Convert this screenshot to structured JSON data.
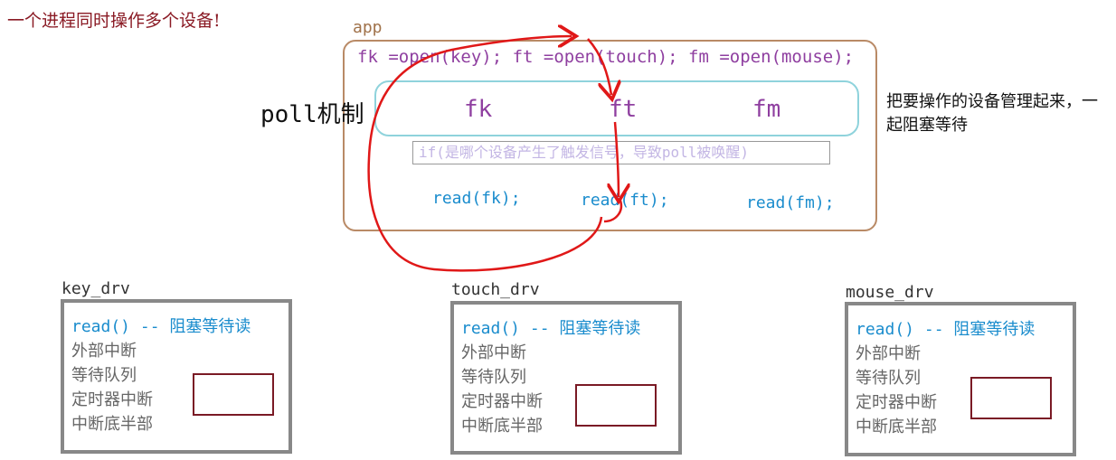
{
  "title": "一个进程同时操作多个设备!",
  "app": {
    "label": "app",
    "open_line": "fk =open(key); ft =open(touch); fm =open(mouse);",
    "poll_label": "poll机制",
    "fds": [
      "fk",
      "ft",
      "fm"
    ],
    "condition": "if(是哪个设备产生了触发信号，导致poll被唤醒)",
    "reads": [
      "read(fk);",
      "read(ft);",
      "read(fm);"
    ]
  },
  "note": "把要操作的设备管理起来，一起阻塞等待",
  "drivers": [
    {
      "label": "key_drv",
      "lines": [
        "read() -- 阻塞等待读",
        "外部中断",
        "等待队列",
        "定时器中断",
        "中断底半部"
      ]
    },
    {
      "label": "touch_drv",
      "lines": [
        "read() -- 阻塞等待读",
        "外部中断",
        "等待队列",
        "定时器中断",
        "中断底半部"
      ]
    },
    {
      "label": "mouse_drv",
      "lines": [
        "read() -- 阻塞等待读",
        "外部中断",
        "等待队列",
        "定时器中断",
        "中断底半部"
      ]
    }
  ],
  "colors": {
    "title": "#8a1a24",
    "app_border": "#b98a66",
    "code_purple": "#8f3fa0",
    "poll_set_border": "#8fd3dc",
    "read_blue": "#1a8ccd",
    "arrow_red": "#e01818",
    "driver_border": "#888888",
    "inner_box": "#7a1a25"
  }
}
